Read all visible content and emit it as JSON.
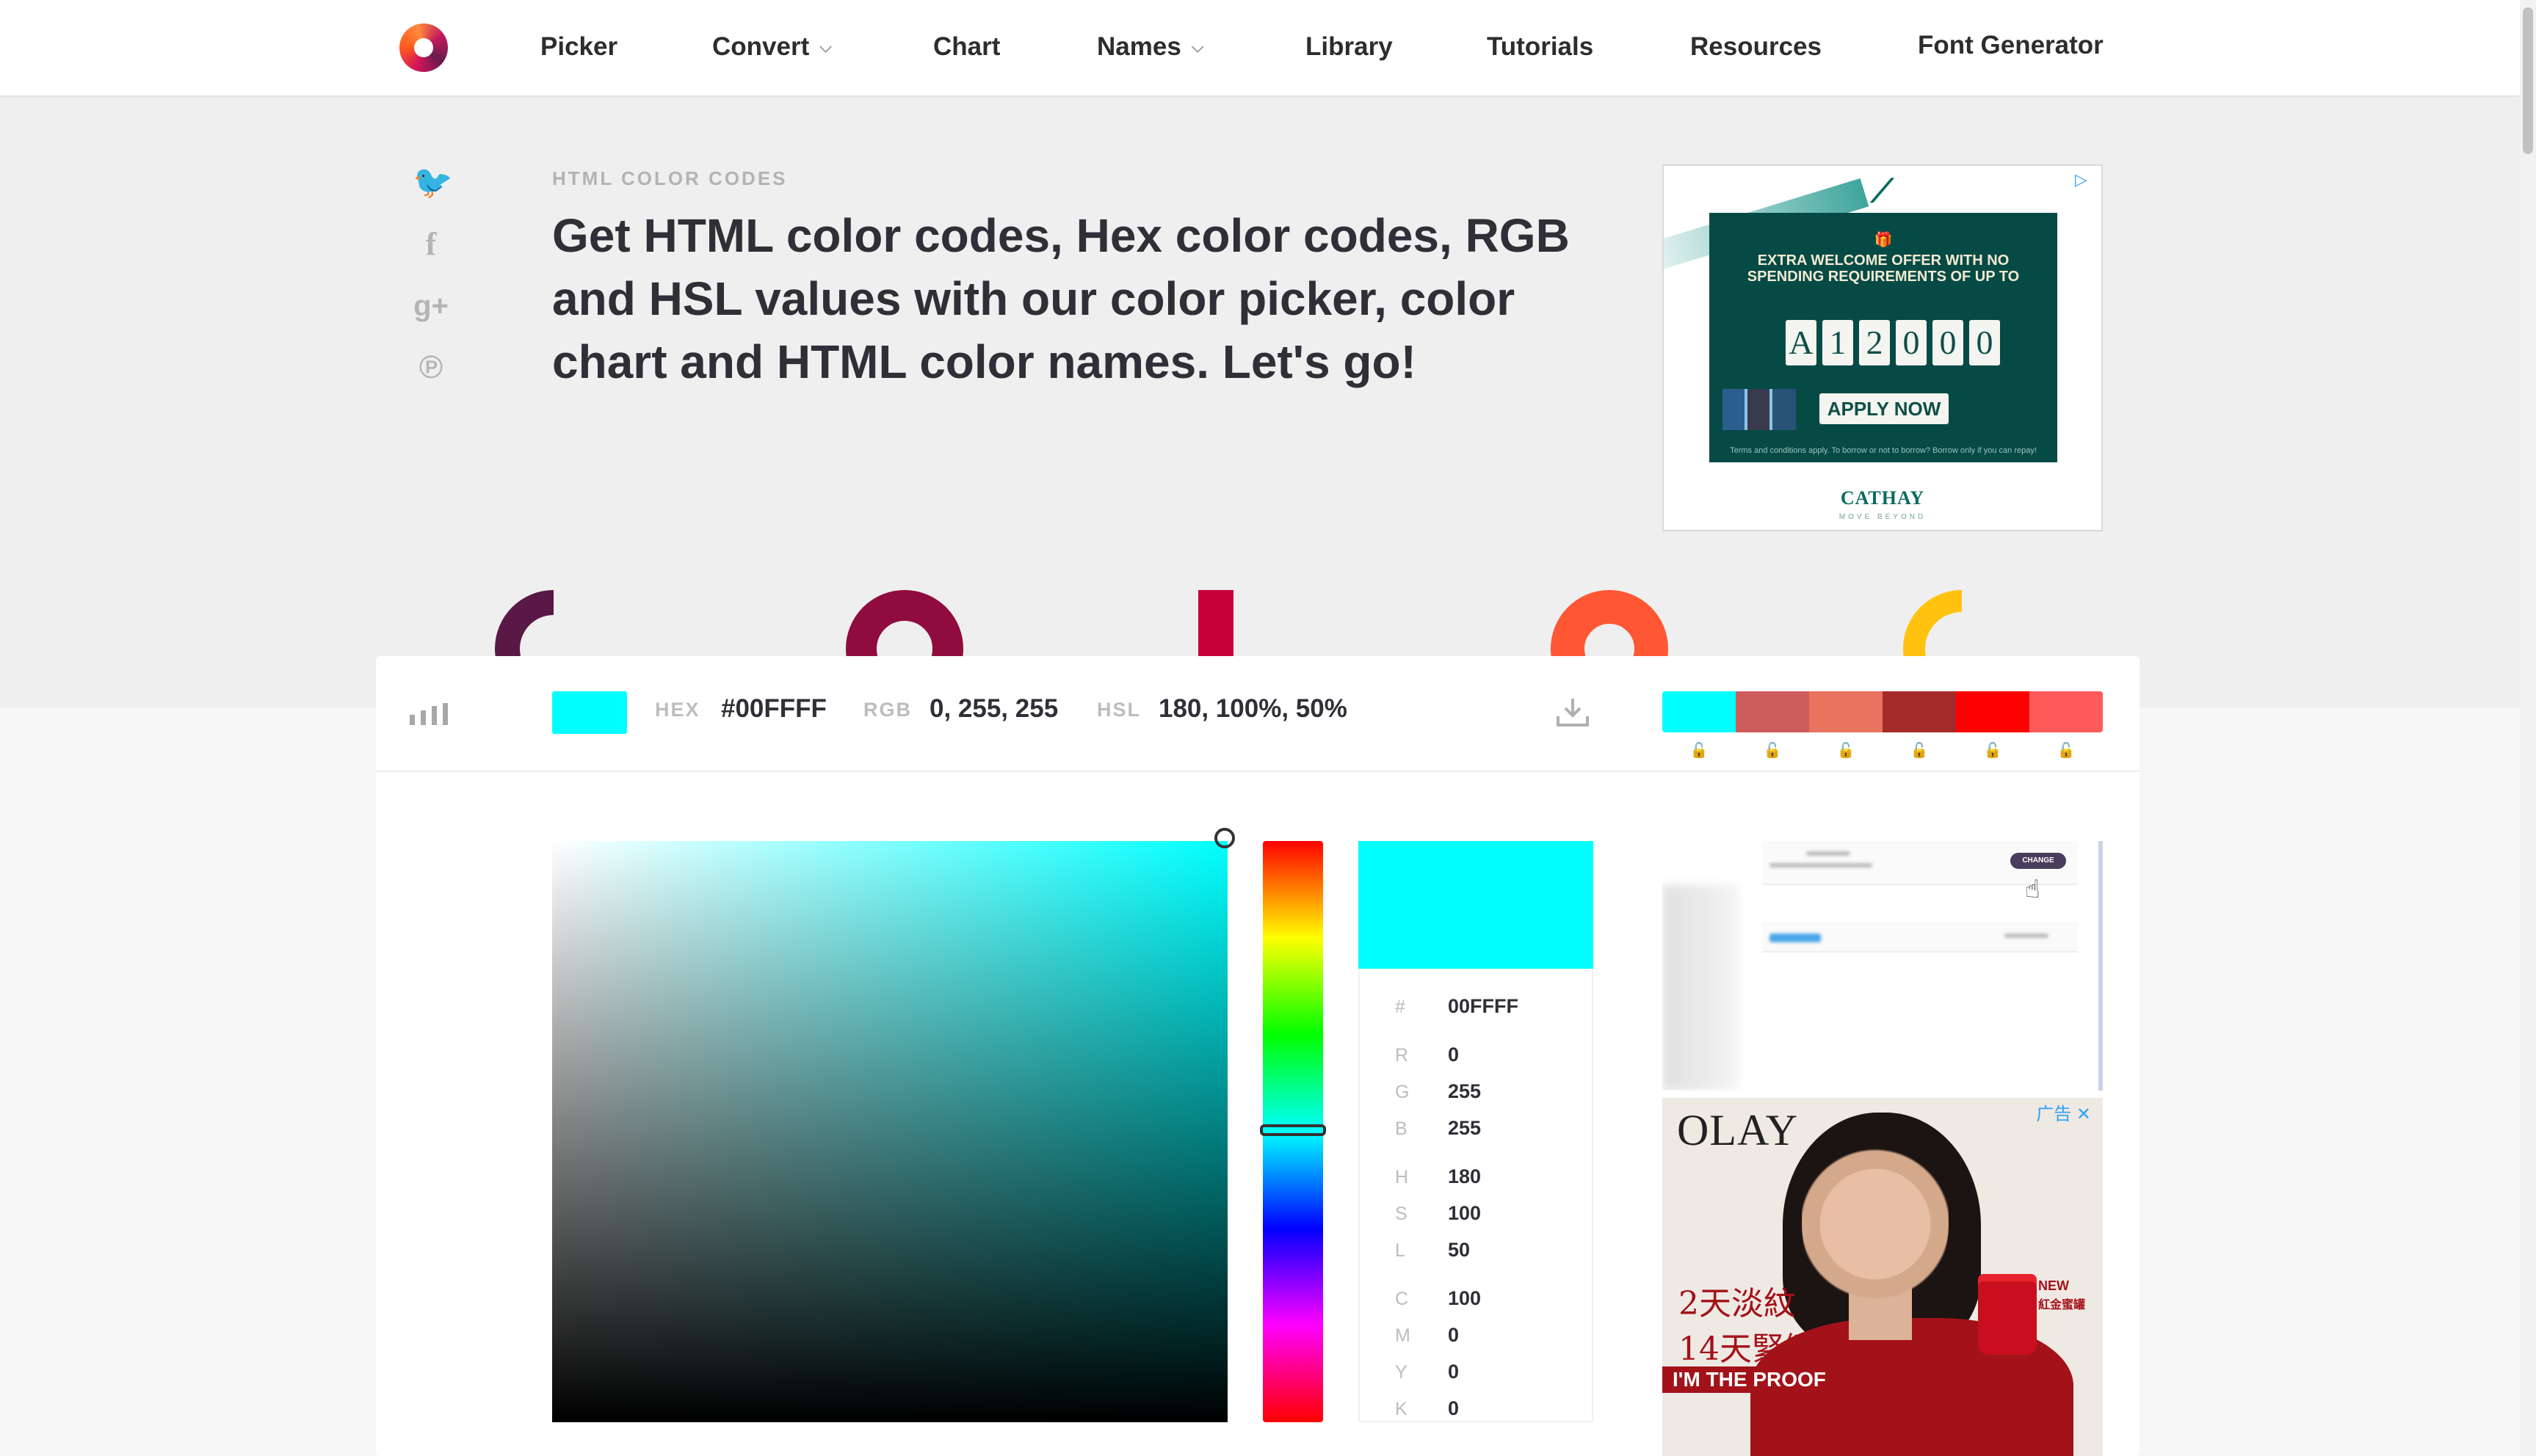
{
  "nav": {
    "items": [
      {
        "label": "Picker",
        "dropdown": false
      },
      {
        "label": "Convert",
        "dropdown": true
      },
      {
        "label": "Chart",
        "dropdown": false
      },
      {
        "label": "Names",
        "dropdown": true
      },
      {
        "label": "Library",
        "dropdown": false
      },
      {
        "label": "Tutorials",
        "dropdown": false
      },
      {
        "label": "Resources",
        "dropdown": false
      },
      {
        "label": "Font Generator",
        "dropdown": false
      }
    ],
    "chevron": "⌵"
  },
  "social_icons": [
    "twitter-icon",
    "facebook-icon",
    "google-plus-icon",
    "pinterest-icon"
  ],
  "social_glyphs": [
    "🐦",
    "f",
    "g+",
    "℗"
  ],
  "hero": {
    "eyebrow": "HTML COLOR CODES",
    "headline": "Get HTML color codes, Hex color codes, RGB and HSL values with our color picker, color chart and HTML color names. Let's go!"
  },
  "ad_top": {
    "text": "EXTRA WELCOME OFFER WITH NO SPENDING REQUIREMENTS OF UP TO",
    "amount_digits": [
      "A",
      "1",
      "2",
      "0",
      "0",
      "0"
    ],
    "button": "APPLY NOW",
    "terms": "Terms and conditions apply. To borrow or not to borrow? Borrow only if you can repay!",
    "brand": "CATHAY",
    "brand_sub": "MOVE BEYOND"
  },
  "decor_colors": [
    "#5a1846",
    "#900c3f",
    "#c70039",
    "#ff5733",
    "#ffc30f"
  ],
  "infobar": {
    "hex_label": "HEX",
    "hex_value": "#00FFFF",
    "rgb_label": "RGB",
    "rgb_value": "0, 255, 255",
    "hsl_label": "HSL",
    "hsl_value": "180, 100%, 50%",
    "swatch_color": "#00ffff"
  },
  "palette": [
    "#00ffff",
    "#cd5c5c",
    "#e9735f",
    "#a52a2a",
    "#ff0000",
    "#ff5b5b"
  ],
  "picker": {
    "selected_color": "#00ffff",
    "hue": 180,
    "saturation": 100,
    "brightness": 100
  },
  "values": {
    "hash": {
      "label": "#",
      "value": "00FFFF"
    },
    "r": {
      "label": "R",
      "value": "0"
    },
    "g": {
      "label": "G",
      "value": "255"
    },
    "b": {
      "label": "B",
      "value": "255"
    },
    "h": {
      "label": "H",
      "value": "180"
    },
    "s": {
      "label": "S",
      "value": "100"
    },
    "l": {
      "label": "L",
      "value": "50"
    },
    "c": {
      "label": "C",
      "value": "100"
    },
    "m": {
      "label": "M",
      "value": "0"
    },
    "y": {
      "label": "Y",
      "value": "0"
    },
    "k": {
      "label": "K",
      "value": "0"
    }
  },
  "ad_mid": {
    "button": "CHANGE"
  },
  "ad_olay": {
    "brand": "OLAY",
    "ad_tag": "广告 ✕",
    "line1": "2天淡紋",
    "line2": "14天緊緻",
    "proof": "I'M THE PROOF",
    "new": "NEW",
    "new_sub": "紅金蜜罐"
  }
}
